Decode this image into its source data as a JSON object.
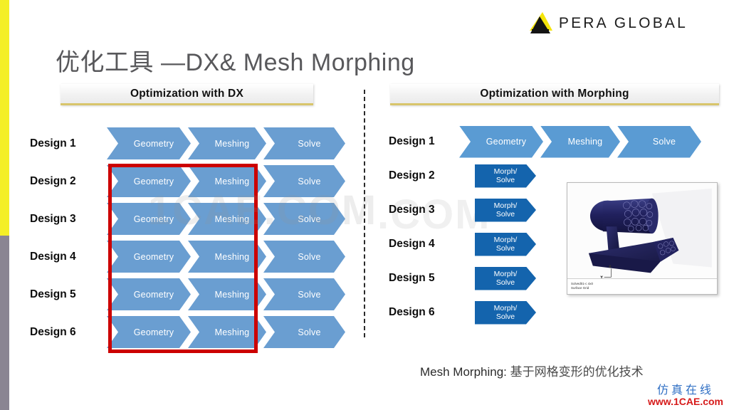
{
  "slide": {
    "title": "优化工具 —DX& Mesh Morphing",
    "background_color": "#ffffff",
    "accent_yellow": "#f4ef26",
    "accent_gray": "#8a8592"
  },
  "logo": {
    "mark_name": "pera-global-triangle-mark",
    "text": "PERA GLOBAL",
    "mark_yellow": "#f5e50a",
    "mark_black": "#141414"
  },
  "left_panel": {
    "header": "Optimization with DX",
    "header_accent": "#d8c56b",
    "chevron_color": "#6a9ed1",
    "rows": [
      {
        "label": "Design 1",
        "steps": [
          "Geometry",
          "Meshing",
          "Solve"
        ]
      },
      {
        "label": "Design 2",
        "steps": [
          "Geometry",
          "Meshing",
          "Solve"
        ]
      },
      {
        "label": "Design 3",
        "steps": [
          "Geometry",
          "Meshing",
          "Solve"
        ]
      },
      {
        "label": "Design 4",
        "steps": [
          "Geometry",
          "Meshing",
          "Solve"
        ]
      },
      {
        "label": "Design 5",
        "steps": [
          "Geometry",
          "Meshing",
          "Solve"
        ]
      },
      {
        "label": "Design 6",
        "steps": [
          "Geometry",
          "Meshing",
          "Solve"
        ]
      }
    ],
    "highlight": {
      "name": "repeated-geometry-meshing-highlight",
      "color": "#cc0000",
      "covers_rows": "Design 2 - Design 6",
      "covers_steps": "Geometry, Meshing"
    }
  },
  "right_panel": {
    "header": "Optimization with Morphing",
    "header_accent": "#d8c56b",
    "chevron_color": "#5a9bd3",
    "morph_color": "#1464ad",
    "rows": [
      {
        "label": "Design 1",
        "steps": [
          "Geometry",
          "Meshing",
          "Solve"
        ],
        "type": "full"
      },
      {
        "label": "Design 2",
        "morph": "Morph/\nSolve",
        "morph_line1": "Morph/",
        "morph_line2": "Solve",
        "type": "morph"
      },
      {
        "label": "Design 3",
        "morph_line1": "Morph/",
        "morph_line2": "Solve",
        "type": "morph"
      },
      {
        "label": "Design 4",
        "morph_line1": "Morph/",
        "morph_line2": "Solve",
        "type": "morph"
      },
      {
        "label": "Design 5",
        "morph_line1": "Morph/",
        "morph_line2": "Solve",
        "type": "morph"
      },
      {
        "label": "Design 6",
        "morph_line1": "Morph/",
        "morph_line2": "Solve",
        "type": "morph"
      }
    ],
    "thumbnail": {
      "name": "cfd-surface-mesh-nacelle-pylon",
      "caption_line1": "Solved01-c  4x0",
      "caption_line2": "Surface Grid",
      "axis_labels": [
        "Z",
        "Y",
        "X"
      ]
    }
  },
  "bottom_caption": {
    "english": "Mesh Morphing: ",
    "chinese": "基于网格变形的优化技术"
  },
  "watermarks": {
    "center": "1CAE.COM",
    "center_secondary": ".COM",
    "corner_cn": "仿真在线",
    "corner_url": "www.1CAE.com",
    "corner_cn_color": "#2f6fc4",
    "corner_url_color": "#d61a1a"
  }
}
